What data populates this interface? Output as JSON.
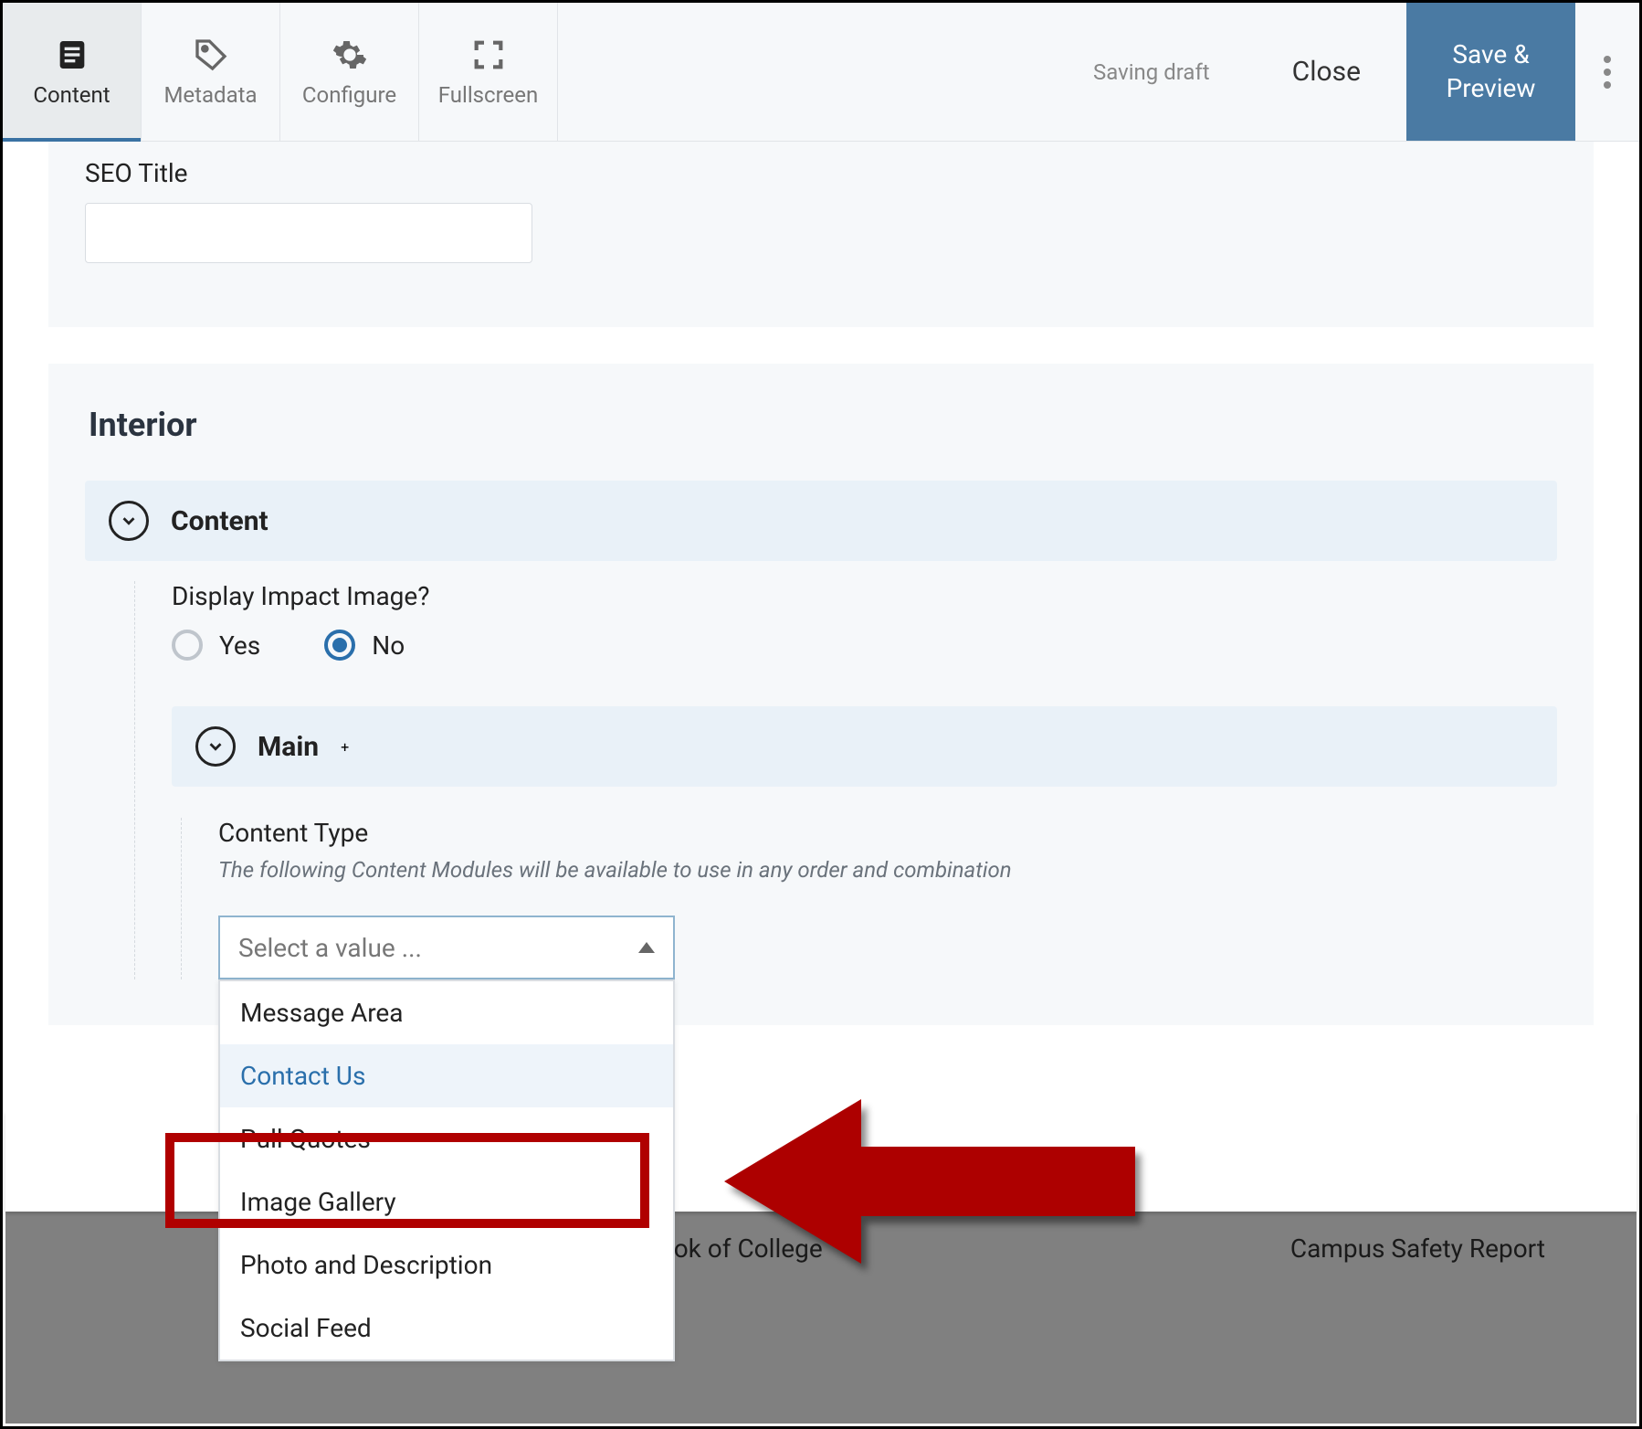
{
  "toolbar": {
    "tabs": [
      {
        "label": "Content"
      },
      {
        "label": "Metadata"
      },
      {
        "label": "Configure"
      },
      {
        "label": "Fullscreen"
      }
    ],
    "status": "Saving draft",
    "close_label": "Close",
    "primary_label": "Save & Preview"
  },
  "seo": {
    "label": "SEO Title",
    "value": ""
  },
  "interior": {
    "title": "Interior",
    "content_header": "Content",
    "impact_label": "Display Impact Image?",
    "impact_yes": "Yes",
    "impact_no": "No",
    "impact_selected": "No",
    "main_header": "Main",
    "content_type_label": "Content Type",
    "content_type_desc": "The following Content Modules will be available to use in any order and combination",
    "select_placeholder": "Select a value ...",
    "options": [
      "Message Area",
      "Contact Us",
      "Pull Quotes",
      "Image Gallery",
      "Photo and Description",
      "Social Feed"
    ]
  },
  "footer": {
    "center": "book of College",
    "right": "Campus Safety Report"
  }
}
